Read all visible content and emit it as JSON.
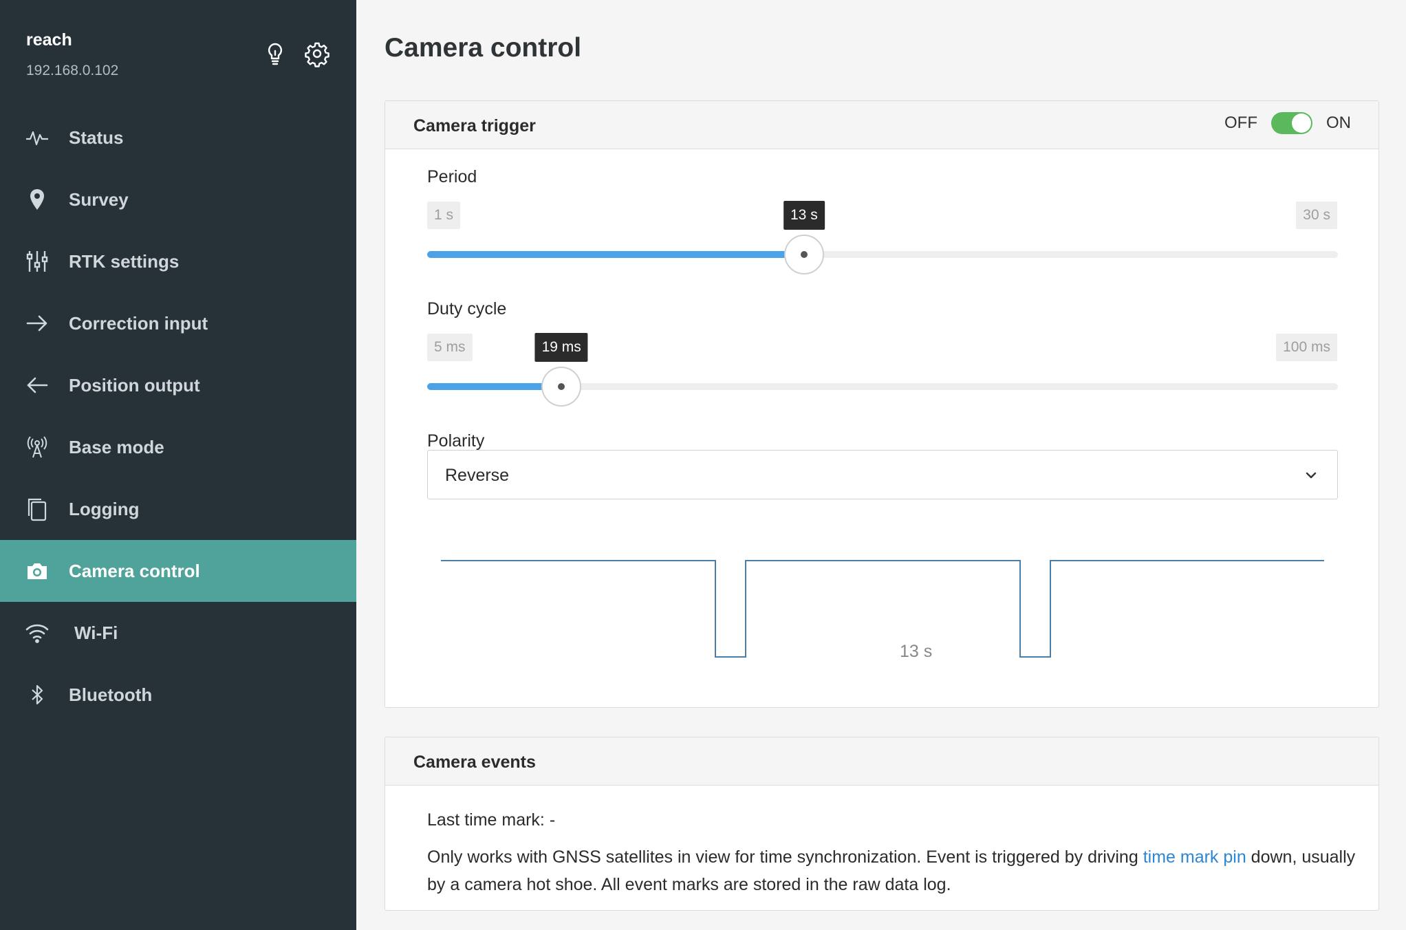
{
  "device": {
    "name": "reach",
    "ip": "192.168.0.102"
  },
  "sidebar": {
    "items": [
      {
        "label": "Status",
        "icon": "pulse-icon"
      },
      {
        "label": "Survey",
        "icon": "map-pin-icon"
      },
      {
        "label": "RTK settings",
        "icon": "sliders-icon"
      },
      {
        "label": "Correction input",
        "icon": "arrow-right-icon"
      },
      {
        "label": "Position output",
        "icon": "arrow-left-icon"
      },
      {
        "label": "Base mode",
        "icon": "antenna-icon"
      },
      {
        "label": "Logging",
        "icon": "files-icon"
      },
      {
        "label": "Camera control",
        "icon": "camera-icon",
        "active": true
      },
      {
        "label": "Wi-Fi",
        "icon": "wifi-icon"
      },
      {
        "label": "Bluetooth",
        "icon": "bluetooth-icon"
      }
    ]
  },
  "page": {
    "title": "Camera control"
  },
  "trigger": {
    "title": "Camera trigger",
    "off_label": "OFF",
    "on_label": "ON",
    "enabled": true,
    "period": {
      "label": "Period",
      "min": "1 s",
      "max": "30 s",
      "value": "13 s",
      "fraction": 0.4138
    },
    "duty": {
      "label": "Duty cycle",
      "min": "5 ms",
      "max": "100 ms",
      "value": "19 ms",
      "fraction": 0.1474
    },
    "polarity": {
      "label": "Polarity",
      "value": "Reverse"
    },
    "waveform_label": "13 s"
  },
  "events": {
    "title": "Camera events",
    "last_mark_label": "Last time mark: -",
    "info_before": "Only works with GNSS satellites in view for time synchronization. Event is triggered by driving ",
    "info_link": "time mark pin",
    "info_after": " down, usually by a camera hot shoe. All event marks are stored in the raw data log."
  },
  "colors": {
    "sidebar_bg": "#263238",
    "active_bg": "#4fa39a",
    "accent": "#4aa3e8",
    "toggle_on": "#5cb85c",
    "link": "#2d86d4"
  }
}
